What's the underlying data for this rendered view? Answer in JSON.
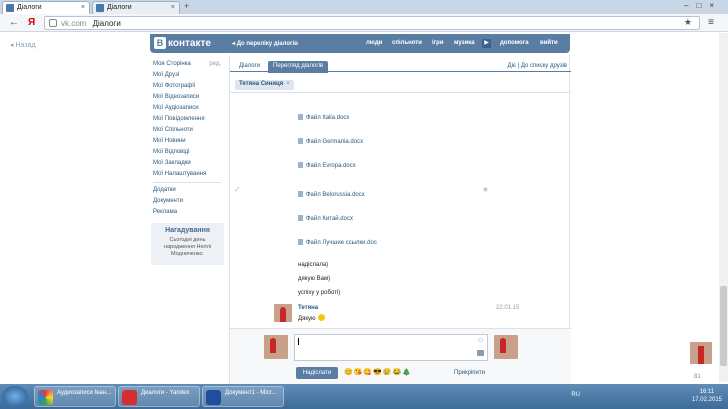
{
  "browser": {
    "tabs": [
      {
        "label": "Діалоги"
      },
      {
        "label": "Діалоги"
      }
    ],
    "url_domain": "vk.com",
    "url_title": "Діалоги"
  },
  "page": {
    "back": "Назад"
  },
  "header": {
    "logo": "контакте",
    "back_to_list": "До переліку діалогів",
    "nav": [
      "люди",
      "спільноти",
      "ігри",
      "музика",
      "допомога",
      "вийти"
    ]
  },
  "sidebar": {
    "edit": "ред.",
    "items": [
      "Моя Сторінка",
      "Мої Друзі",
      "Мої Фотографії",
      "Мої Відеозаписи",
      "Мої Аудіозаписи",
      "Мої Повідомлення",
      "Мої Спільноти",
      "Мої Новини",
      "Мої Відповіді",
      "Мої Закладки",
      "Мої Налаштування"
    ],
    "extra": [
      "Додатки",
      "Документи",
      "Реклама"
    ],
    "reminder_title": "Нагадування",
    "reminder_body": "Сьогодні день народження Неллі Модниченко."
  },
  "dialog": {
    "tab_dialogs": "Діалоги",
    "tab_view": "Перегляд діалогів",
    "right_links": "Діє | До списку друзів",
    "chip": "Тетяна Синиця",
    "files": [
      "Файл Italia.docx",
      "Файл Germania.docx",
      "Файл Evropa.docx",
      "Файл Belorussia.docx",
      "Файл Китай.docx",
      "Файл Лучшие ссылки.doc"
    ],
    "lines": [
      "надіслала)",
      "дякую Вам)",
      "успіху у роботі)"
    ],
    "sender": "Тетяна",
    "date": "22.01.15",
    "last_msg": "Дякую"
  },
  "compose": {
    "send": "Надіслати",
    "attach": "Прикріпити"
  },
  "side": {
    "count": "81"
  },
  "taskbar": {
    "tasks": [
      "Аудиозаписи Іван...",
      "Диалоги - Yandex",
      "Документ1 - Micr..."
    ],
    "lang": "RU",
    "time": "16:11",
    "date": "17.02.2015"
  }
}
